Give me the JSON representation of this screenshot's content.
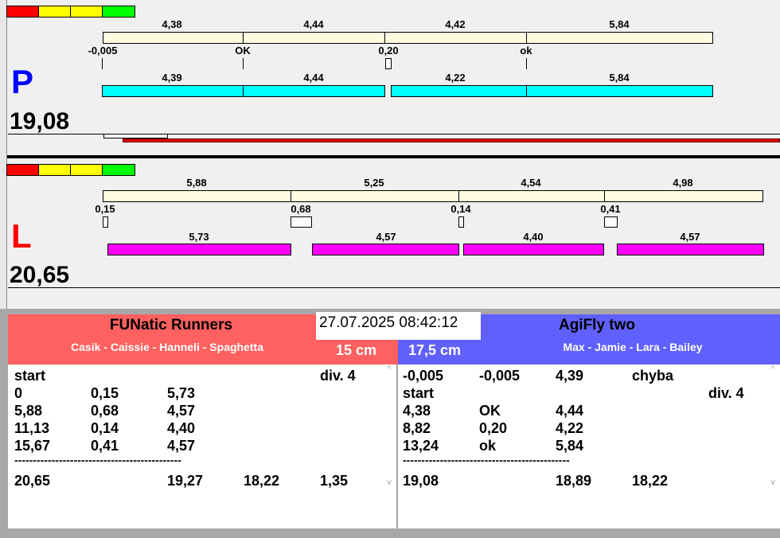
{
  "colors": {
    "red": "#ff0000",
    "yellow": "#ffff00",
    "green": "#00ff00",
    "left_team": "#ff6060",
    "right_team": "#6060ff",
    "cyan": "#00ffff",
    "magenta": "#ff00ff"
  },
  "p_panel": {
    "letter": "P",
    "total": "19,08",
    "top_labels": [
      "4,38",
      "4,44",
      "4,42",
      "5,84"
    ],
    "mid_labels": [
      "-0,005",
      "OK",
      "0,20",
      "ok"
    ],
    "bar_labels": [
      "4,39",
      "4,44",
      "4,22",
      "5,84"
    ]
  },
  "l_panel": {
    "letter": "L",
    "total": "20,65",
    "top_labels": [
      "5,88",
      "5,25",
      "4,54",
      "4,98"
    ],
    "mid_labels": [
      "0,15",
      "0,68",
      "0,14",
      "0,41"
    ],
    "bar_labels": [
      "5,73",
      "4,57",
      "4,40",
      "4,57"
    ]
  },
  "datetime": "27.07.2025 08:42:12",
  "left_team": {
    "name": "FUNatic Runners",
    "dogs": "Casik - Caissie - Hanneli - Spaghetta",
    "height": "15 cm",
    "rows": [
      [
        "start",
        "",
        "",
        "",
        "div.  4"
      ],
      [
        "0",
        "0,15",
        "5,73",
        "",
        ""
      ],
      [
        "5,88",
        "0,68",
        "4,57",
        "",
        ""
      ],
      [
        "11,13",
        "0,14",
        "4,40",
        "",
        ""
      ],
      [
        "15,67",
        "0,41",
        "4,57",
        "",
        ""
      ]
    ],
    "separator": "---------------------------------------------",
    "totals": [
      "20,65",
      "",
      "19,27",
      "18,22",
      "1,35"
    ]
  },
  "right_team": {
    "name": "AgiFly two",
    "dogs": "Max - Jamie - Lara - Bailey",
    "height": "17,5 cm",
    "rows": [
      [
        "-0,005",
        "-0,005",
        "4,39",
        "chyba",
        ""
      ],
      [
        "start",
        "",
        "",
        "",
        "div.  4"
      ],
      [
        "4,38",
        "OK",
        "4,44",
        "",
        ""
      ],
      [
        "8,82",
        "0,20",
        "4,22",
        "",
        ""
      ],
      [
        "13,24",
        "ok",
        "5,84",
        "",
        ""
      ]
    ],
    "separator": "---------------------------------------------",
    "totals": [
      "19,08",
      "",
      "18,89",
      "18,22",
      ""
    ]
  }
}
